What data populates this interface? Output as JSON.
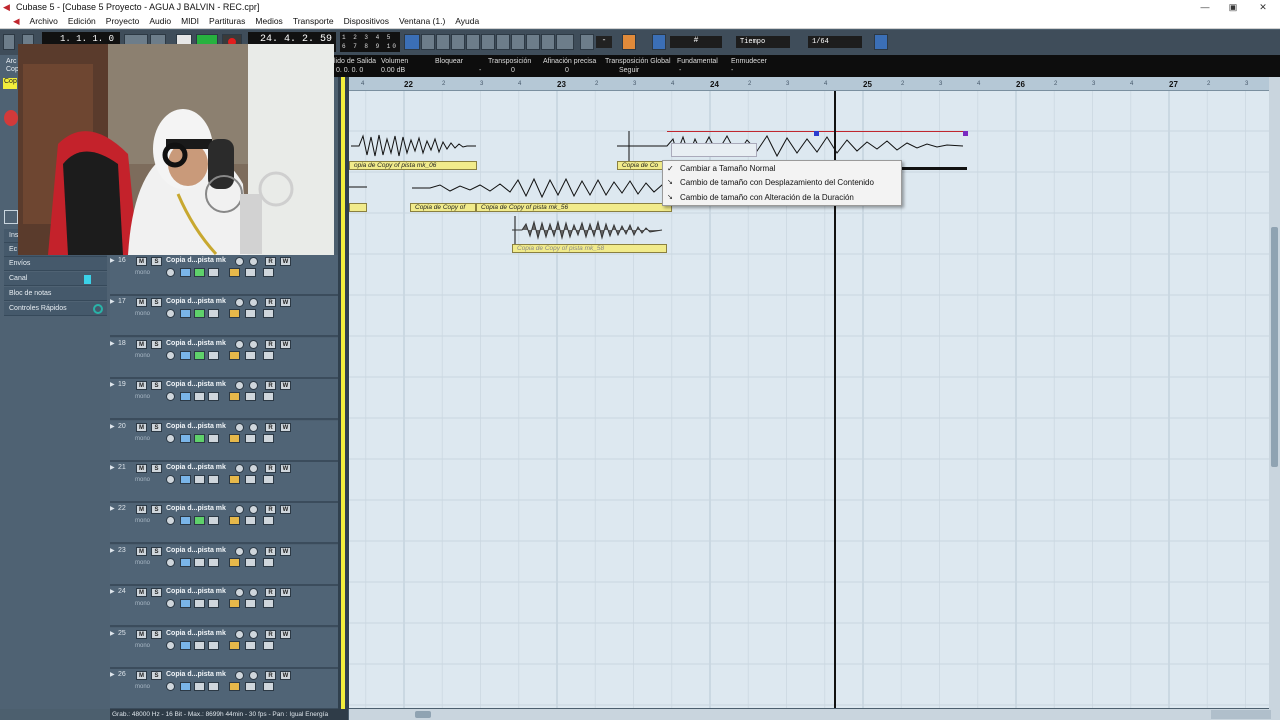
{
  "window": {
    "title": "Cubase 5 - [Cubase 5 Proyecto - AGUA J BALVIN - REC.cpr]"
  },
  "menu": [
    "Archivo",
    "Edición",
    "Proyecto",
    "Audio",
    "MIDI",
    "Partituras",
    "Medios",
    "Transporte",
    "Dispositivos",
    "Ventana (1.)",
    "Ayuda"
  ],
  "transport": {
    "position_a": "1. 1. 1.   0",
    "position_b": "24. 4. 2. 59",
    "quantize_values": [
      "1",
      "2",
      "3",
      "4",
      "5",
      "6",
      "7",
      "8",
      "9",
      "10"
    ]
  },
  "toolbar": {
    "grid_type": "Tiempo",
    "quantize": "1/64",
    "snap_value": "-"
  },
  "infoline": {
    "labels": [
      "lido de Salida",
      "Volumen",
      "Bloquear",
      "Transposición",
      "Afinación precisa",
      "Transposición Global",
      "Fundamental",
      "Enmudecer"
    ],
    "values": [
      "0. 0. 0.   0",
      "0.00 dB",
      "-",
      "0",
      "0",
      "Seguir",
      "-",
      "-"
    ]
  },
  "inspector": {
    "partial_labels": [
      "Arc",
      "Cop",
      "Cop",
      "Ins",
      "Ec"
    ],
    "sections": [
      "Envíos",
      "Canal",
      "Bloc de notas",
      "Controles Rápidos"
    ]
  },
  "ruler": {
    "bars": [
      "22",
      "23",
      "24",
      "25",
      "26",
      "27"
    ],
    "beats": [
      "2",
      "3",
      "4"
    ]
  },
  "tracks": [
    {
      "num": "16",
      "name": "Copia d...pista mk",
      "type": "mono"
    },
    {
      "num": "17",
      "name": "Copia d...pista mk",
      "type": "mono"
    },
    {
      "num": "18",
      "name": "Copia d...pista mk",
      "type": "mono"
    },
    {
      "num": "19",
      "name": "Copia d...pista mk",
      "type": "mono"
    },
    {
      "num": "20",
      "name": "Copia d...pista mk",
      "type": "mono"
    },
    {
      "num": "21",
      "name": "Copia d...pista mk",
      "type": "mono"
    },
    {
      "num": "22",
      "name": "Copia d...pista mk",
      "type": "mono"
    },
    {
      "num": "23",
      "name": "Copia d...pista mk",
      "type": "mono"
    },
    {
      "num": "24",
      "name": "Copia d...pista mk",
      "type": "mono"
    },
    {
      "num": "25",
      "name": "Copia d...pista mk",
      "type": "mono"
    },
    {
      "num": "26",
      "name": "Copia d...pista mk",
      "type": "mono"
    }
  ],
  "track_buttons": {
    "mute": "M",
    "solo": "S",
    "read": "R",
    "write": "W"
  },
  "clips": {
    "clip_06": "opia de Copy of pista mk_06",
    "clip_c": "Copia de Co",
    "clip_copy": "Copia de Copy of",
    "clip_56": "Copia de Copy of pista mk_56",
    "clip_58": "Copia de Copy of pista mk_58"
  },
  "context_menu": {
    "items": [
      "Cambiar a Tamaño Normal",
      "Cambio de tamaño con Desplazamiento del Contenido",
      "Cambio de tamaño con Alteración de la Duración"
    ],
    "checked_index": 0
  },
  "status": {
    "text": "Grab.: 48000 Hz - 16 Bit - Max.: 8699h 44min - 30 fps - Pan : Igual Energía"
  },
  "icons": [
    "cubase-logo-icon",
    "minimize-icon",
    "maximize-icon",
    "close-icon",
    "play-icon",
    "stop-icon",
    "record-icon",
    "cycle-icon",
    "pointer-tool-icon",
    "range-tool-icon",
    "split-tool-icon",
    "glue-tool-icon",
    "erase-tool-icon",
    "zoom-tool-icon",
    "mute-tool-icon",
    "time-warp-icon",
    "draw-tool-icon",
    "snap-icon",
    "grid-icon",
    "monitor-icon",
    "automation-read-icon",
    "automation-write-icon"
  ],
  "colors": {
    "title_bg": "#ffffff",
    "arrange_bg": "#dde8f0",
    "clip_yellow": "#f1eb8b",
    "track_panel": "#506476",
    "ruler": "#b5c8d6",
    "selection": "#c0262e"
  }
}
